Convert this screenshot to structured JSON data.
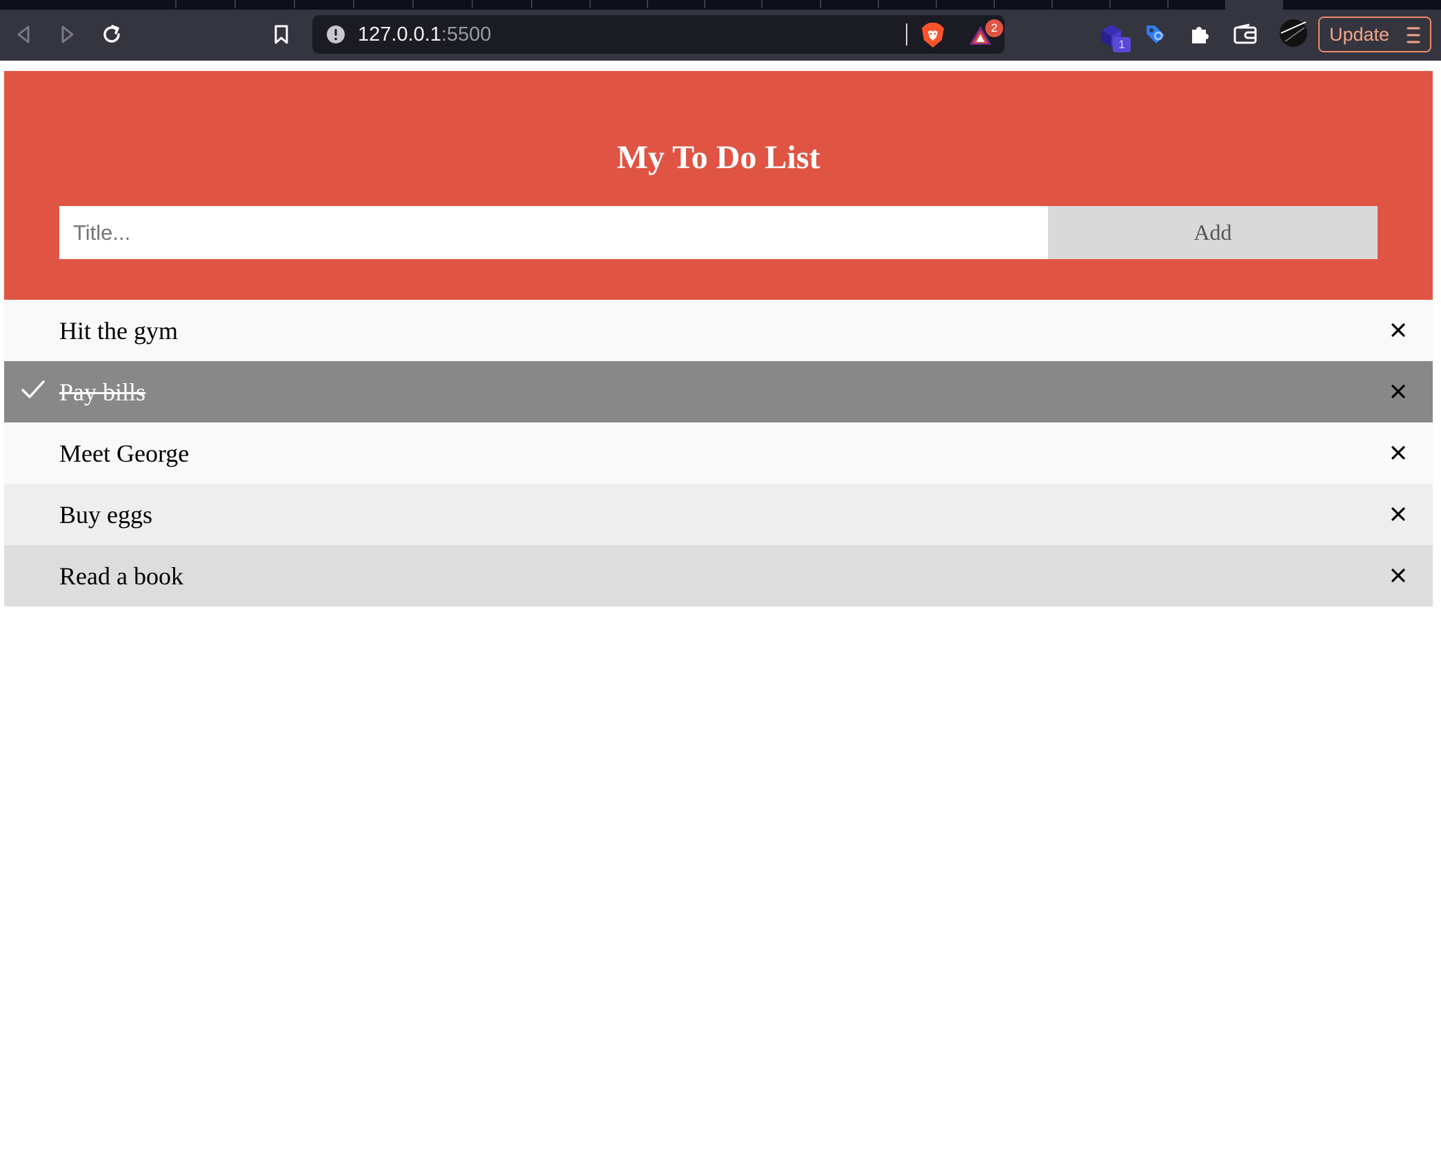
{
  "browser": {
    "address": {
      "host": "127.0.0.1",
      "port": ":5500"
    },
    "shields_badge": "2",
    "extension_badge": "1",
    "update_label": "Update"
  },
  "app": {
    "title": "My To Do List",
    "input": {
      "placeholder": "Title...",
      "value": ""
    },
    "add_label": "Add",
    "items": [
      {
        "text": "Hit the gym",
        "checked": false,
        "bg": "#f9f9f9"
      },
      {
        "text": "Pay bills",
        "checked": true,
        "bg": "#888888"
      },
      {
        "text": "Meet George",
        "checked": false,
        "bg": "#f9f9f9"
      },
      {
        "text": "Buy eggs",
        "checked": false,
        "bg": "#eeeeee"
      },
      {
        "text": "Read a book",
        "checked": false,
        "bg": "#dddddd"
      }
    ]
  },
  "colors": {
    "header_bg": "#e05444",
    "add_button_bg": "#d9d9d9",
    "checked_bg": "#888888"
  }
}
